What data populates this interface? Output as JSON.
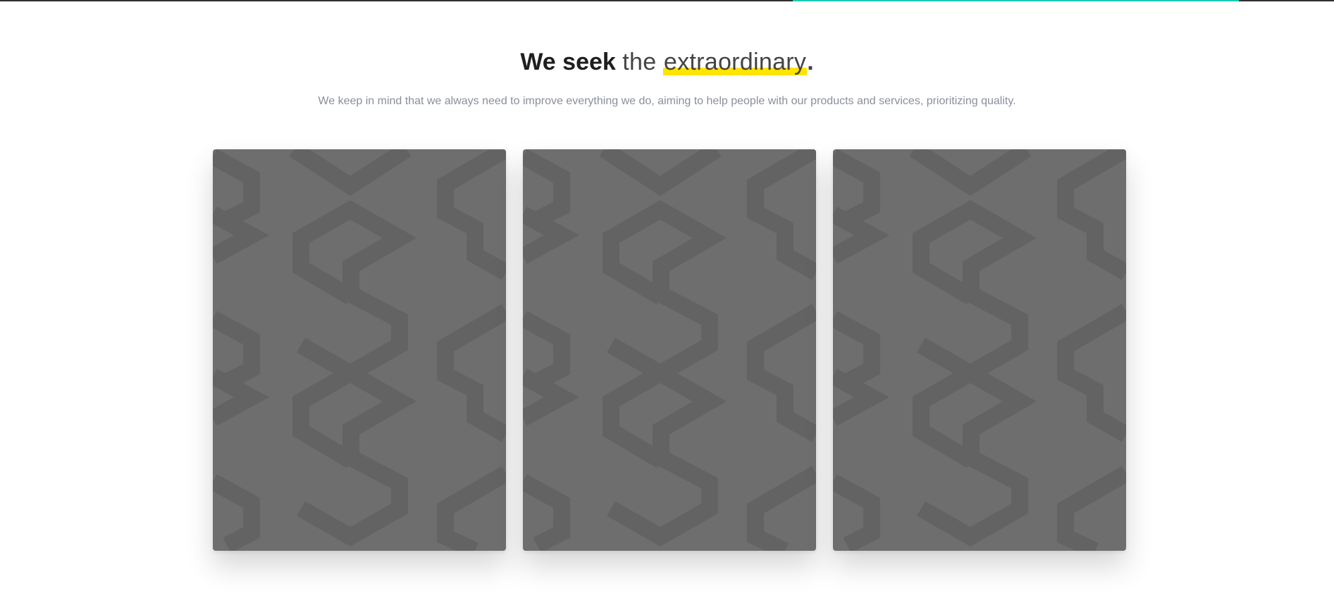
{
  "hero": {
    "headline_bold": "We seek",
    "headline_light": "the",
    "headline_highlight": "extraordinary",
    "headline_end": ".",
    "subtitle": "We keep in mind that we always need to improve everything we do, aiming to help people with our products and services, prioritizing quality."
  },
  "cards": [
    {
      "pattern_icon": "s-logo-pattern-icon"
    },
    {
      "pattern_icon": "s-logo-pattern-icon"
    },
    {
      "pattern_icon": "s-logo-pattern-icon"
    }
  ],
  "colors": {
    "accent_line": "#1ec9b7",
    "highlight": "#ffe400",
    "card_background": "#6e6e6e",
    "pattern": "#636363",
    "top_bar": "#2f2f2f"
  }
}
